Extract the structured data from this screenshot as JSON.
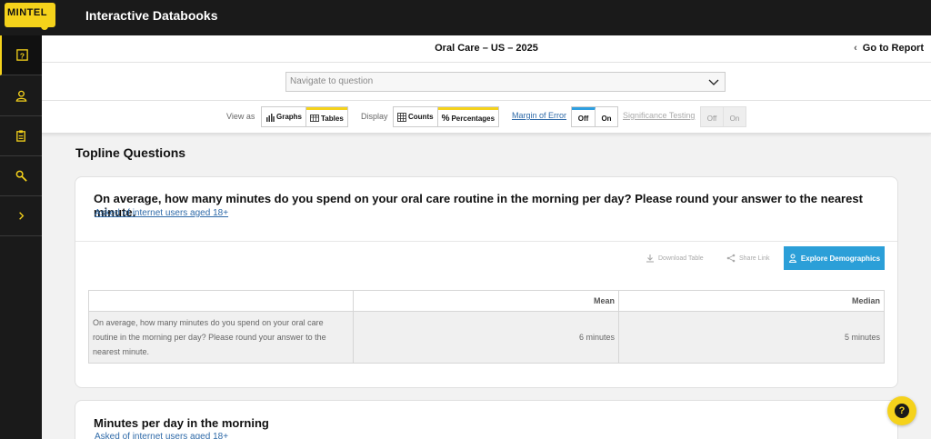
{
  "brand": {
    "logo_text": "MINTEL",
    "app_title": "Interactive Databooks"
  },
  "sidebar": {
    "items": [
      {
        "icon": "question-icon",
        "active": true
      },
      {
        "icon": "user-icon"
      },
      {
        "icon": "clipboard-icon"
      },
      {
        "icon": "key-search-icon"
      },
      {
        "icon": "chevron-right-icon"
      }
    ]
  },
  "header": {
    "title": "Oral Care – US – 2025",
    "go_to_report": "Go to Report"
  },
  "navigator": {
    "placeholder": "Navigate to question"
  },
  "view_options": {
    "view_as_label": "View as",
    "graphs_label": "Graphs",
    "tables_label": "Tables",
    "display_label": "Display",
    "counts_label": "Counts",
    "percentages_label": "Percentages",
    "margin_of_error_label": "Margin of Error",
    "moe_off": "Off",
    "moe_on": "On",
    "significance_label": "Significance Testing",
    "sig_off": "Off",
    "sig_on": "On"
  },
  "section_title": "Topline Questions",
  "question_card": {
    "question": "On average, how many minutes do you spend on your oral care routine in the morning per day? Please round your answer to the nearest minute.",
    "base": "Asked of internet users aged 18+",
    "download_label": "Download Table",
    "share_label": "Share Link",
    "explore_label": "Explore Demographics",
    "table": {
      "headers": [
        "",
        "Mean",
        "Median"
      ],
      "rows": [
        {
          "label": "On average, how many minutes do you spend on your oral care routine in the morning per day? Please round your answer to the nearest minute.",
          "mean": "6 minutes",
          "median": "5 minutes"
        }
      ]
    }
  },
  "next_card": {
    "title": "Minutes per day in the morning",
    "base": "Asked of internet users aged 18+"
  },
  "colors": {
    "accent_yellow": "#f5d21b",
    "accent_blue": "#2b9fd8",
    "dark": "#1a1a1a"
  }
}
